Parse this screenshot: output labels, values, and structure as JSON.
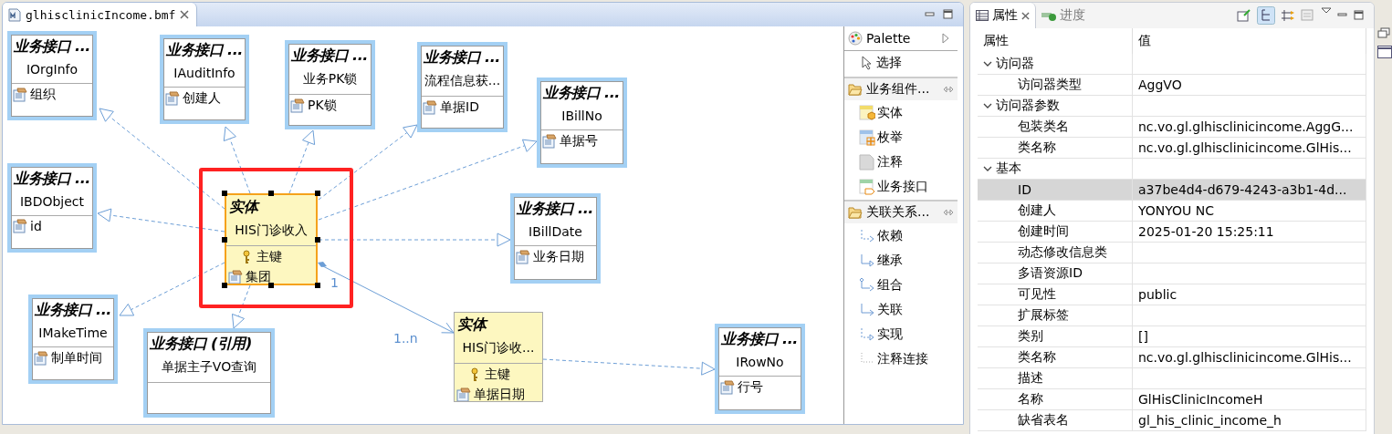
{
  "editor": {
    "tab": {
      "title": "glhisclinicIncome.bmf"
    }
  },
  "diagram": {
    "nodes": [
      {
        "kind": "interface",
        "stereotype": "业务接口 ...",
        "name": "IOrgInfo",
        "selected": false,
        "attributes": [
          {
            "kind": "field",
            "label": "组织"
          }
        ]
      },
      {
        "kind": "interface",
        "stereotype": "业务接口 ...",
        "name": "IAuditInfo",
        "selected": false,
        "attributes": [
          {
            "kind": "field",
            "label": "创建人"
          }
        ]
      },
      {
        "kind": "interface",
        "stereotype": "业务接口 ...",
        "name": "业务PK锁",
        "selected": false,
        "attributes": [
          {
            "kind": "field",
            "label": "PK锁"
          }
        ]
      },
      {
        "kind": "interface",
        "stereotype": "业务接口 ...",
        "name": "流程信息获...",
        "selected": false,
        "attributes": [
          {
            "kind": "field",
            "label": "单据ID"
          }
        ]
      },
      {
        "kind": "interface",
        "stereotype": "业务接口 ...",
        "name": "IBillNo",
        "selected": false,
        "attributes": [
          {
            "kind": "field",
            "label": "单据号"
          }
        ]
      },
      {
        "kind": "interface",
        "stereotype": "业务接口 ...",
        "name": "IBDObject",
        "selected": false,
        "attributes": [
          {
            "kind": "field",
            "label": "id"
          }
        ]
      },
      {
        "kind": "entity",
        "stereotype": "实体",
        "name": "HIS门诊收入",
        "selected": true,
        "attributes": [
          {
            "kind": "key",
            "label": "主键"
          },
          {
            "kind": "field",
            "label": "集团"
          }
        ]
      },
      {
        "kind": "interface",
        "stereotype": "业务接口 ...",
        "name": "IBillDate",
        "selected": false,
        "attributes": [
          {
            "kind": "field",
            "label": "业务日期"
          }
        ]
      },
      {
        "kind": "interface",
        "stereotype": "业务接口 ...",
        "name": "IMakeTime",
        "selected": false,
        "attributes": [
          {
            "kind": "field",
            "label": "制单时间"
          }
        ]
      },
      {
        "kind": "interface",
        "stereotype": "业务接口 (引用)",
        "name": "单据主子VO查询",
        "selected": false
      },
      {
        "kind": "entity",
        "stereotype": "实体",
        "name": "HIS门诊收...",
        "selected": false,
        "attributes": [
          {
            "kind": "key",
            "label": "主键"
          },
          {
            "kind": "field",
            "label": "单据日期"
          }
        ]
      },
      {
        "kind": "interface",
        "stereotype": "业务接口 ...",
        "name": "IRowNo",
        "selected": false,
        "attributes": [
          {
            "kind": "field",
            "label": "行号"
          }
        ]
      }
    ],
    "composition": {
      "source_label": "1",
      "target_label": "1..n"
    }
  },
  "palette": {
    "title": "Palette",
    "tool": "选择",
    "drawers": [
      {
        "label": "业务组件...",
        "items": [
          {
            "kind": "entity",
            "label": "实体"
          },
          {
            "kind": "enum",
            "label": "枚举"
          },
          {
            "kind": "note",
            "label": "注释"
          },
          {
            "kind": "interface",
            "label": "业务接口"
          }
        ]
      },
      {
        "label": "关联关系...",
        "items": [
          {
            "kind": "dependency",
            "label": "依赖"
          },
          {
            "kind": "inheritance",
            "label": "继承"
          },
          {
            "kind": "composition",
            "label": "组合"
          },
          {
            "kind": "association",
            "label": "关联"
          },
          {
            "kind": "realization",
            "label": "实现"
          },
          {
            "kind": "notelink",
            "label": "注释连接"
          }
        ]
      }
    ]
  },
  "properties": {
    "tabs": [
      {
        "label": "属性",
        "selected": true
      },
      {
        "label": "进度",
        "selected": false
      }
    ],
    "columns": [
      "属性",
      "值"
    ],
    "groups": [
      {
        "label": "访问器",
        "expanded": true,
        "children": [
          {
            "name": "访问器类型",
            "value": "AggVO",
            "selected": false
          }
        ]
      },
      {
        "label": "访问器参数",
        "expanded": true,
        "children": [
          {
            "name": "包装类名",
            "value": "nc.vo.gl.glhisclinicincome.AggG...",
            "selected": false
          },
          {
            "name": "类名称",
            "value": "nc.vo.gl.glhisclinicincome.GlHis...",
            "selected": false
          }
        ]
      },
      {
        "label": "基本",
        "expanded": true,
        "children": [
          {
            "name": "ID",
            "value": "a37be4d4-d679-4243-a3b1-4d...",
            "selected": true
          },
          {
            "name": "创建人",
            "value": "YONYOU NC",
            "selected": false
          },
          {
            "name": "创建时间",
            "value": "2025-01-20 15:25:11",
            "selected": false
          },
          {
            "name": "动态修改信息类",
            "selected": false
          },
          {
            "name": "多语资源ID",
            "selected": false
          },
          {
            "name": "可见性",
            "value": "public",
            "selected": false
          },
          {
            "name": "扩展标签",
            "selected": false
          },
          {
            "name": "类别",
            "value": "[]",
            "selected": false
          },
          {
            "name": "类名称",
            "value": "nc.vo.gl.glhisclinicincome.GlHis...",
            "selected": false
          },
          {
            "name": "描述",
            "selected": false
          },
          {
            "name": "名称",
            "value": "GlHisClinicIncomeH",
            "selected": false
          },
          {
            "name": "缺省表名",
            "value": "gl_his_clinic_income_h",
            "selected": false
          }
        ]
      }
    ]
  }
}
